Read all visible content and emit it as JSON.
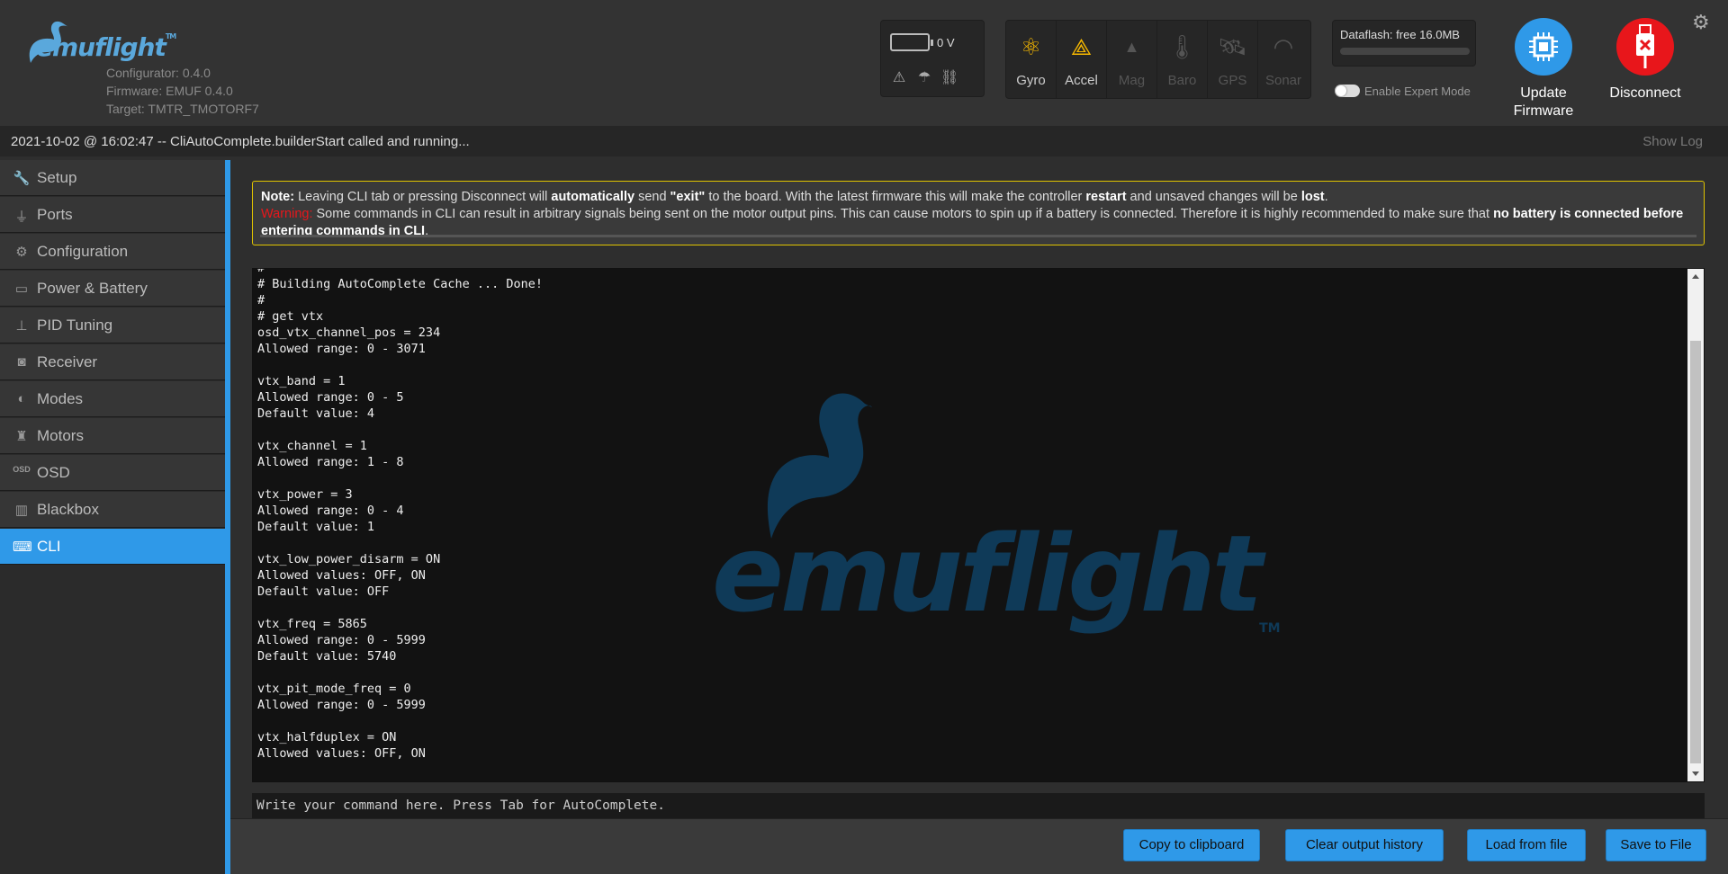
{
  "header": {
    "logo_text": "emuflight",
    "logo_tm": "TM",
    "configurator_version": "Configurator: 0.4.0",
    "firmware_version": "Firmware: EMUF 0.4.0",
    "target": "Target: TMTR_TMOTORF7",
    "battery_voltage": "0 V",
    "sensors": [
      {
        "label": "Gyro",
        "icon": "gyro-icon",
        "active": true
      },
      {
        "label": "Accel",
        "icon": "accel-icon",
        "active": true
      },
      {
        "label": "Mag",
        "icon": "mag-icon",
        "active": false
      },
      {
        "label": "Baro",
        "icon": "baro-icon",
        "active": false
      },
      {
        "label": "GPS",
        "icon": "gps-icon",
        "active": false
      },
      {
        "label": "Sonar",
        "icon": "sonar-icon",
        "active": false
      }
    ],
    "dataflash_label": "Dataflash: free 16.0MB",
    "expert_mode_label": "Enable Expert Mode",
    "update_firmware_label_1": "Update",
    "update_firmware_label_2": "Firmware",
    "disconnect_label": "Disconnect"
  },
  "logbar": {
    "message": "2021-10-02 @ 16:02:47 -- CliAutoComplete.builderStart called and running...",
    "show_log": "Show Log"
  },
  "sidebar": {
    "items": [
      {
        "label": "Setup",
        "icon": "wrench-icon"
      },
      {
        "label": "Ports",
        "icon": "plug-icon"
      },
      {
        "label": "Configuration",
        "icon": "gear-icon"
      },
      {
        "label": "Power & Battery",
        "icon": "battery-icon"
      },
      {
        "label": "PID Tuning",
        "icon": "sitemap-icon"
      },
      {
        "label": "Receiver",
        "icon": "robot-icon"
      },
      {
        "label": "Modes",
        "icon": "toggle-icon"
      },
      {
        "label": "Motors",
        "icon": "motor-icon"
      },
      {
        "label": "OSD",
        "icon": "osd-icon"
      },
      {
        "label": "Blackbox",
        "icon": "blackbox-icon"
      },
      {
        "label": "CLI",
        "icon": "terminal-icon"
      }
    ],
    "active": "CLI"
  },
  "note": {
    "note_label": "Note:",
    "note_text_1": " Leaving CLI tab or pressing Disconnect will ",
    "note_bold_1": "automatically",
    "note_text_2": " send ",
    "note_bold_2": "\"exit\"",
    "note_text_3": " to the board. With the latest firmware this will make the controller ",
    "note_bold_3": "restart",
    "note_text_4": " and unsaved changes will be ",
    "note_bold_4": "lost",
    "note_text_5": ".",
    "warning_label": "Warning:",
    "warning_text": " Some commands in CLI can result in arbitrary signals being sent on the motor output pins. This can cause motors to spin up if a battery is connected. Therefore it is highly recommended to make sure that ",
    "warning_bold": "no battery is connected before entering commands in CLI",
    "warning_end": "."
  },
  "console": {
    "watermark": "emuflight",
    "watermark_tm": "TM",
    "lines": [
      "#",
      "# Building AutoComplete Cache ... Done!",
      "#",
      "# get vtx",
      "osd_vtx_channel_pos = 234",
      "Allowed range: 0 - 3071",
      "",
      "vtx_band = 1",
      "Allowed range: 0 - 5",
      "Default value: 4",
      "",
      "vtx_channel = 1",
      "Allowed range: 1 - 8",
      "",
      "vtx_power = 3",
      "Allowed range: 0 - 4",
      "Default value: 1",
      "",
      "vtx_low_power_disarm = ON",
      "Allowed values: OFF, ON",
      "Default value: OFF",
      "",
      "vtx_freq = 5865",
      "Allowed range: 0 - 5999",
      "Default value: 5740",
      "",
      "vtx_pit_mode_freq = 0",
      "Allowed range: 0 - 5999",
      "",
      "vtx_halfduplex = ON",
      "Allowed values: OFF, ON"
    ]
  },
  "command_input": {
    "placeholder": "Write your command here. Press Tab for AutoComplete."
  },
  "actions": {
    "copy": "Copy to clipboard",
    "clear": "Clear output history",
    "load": "Load from file",
    "save": "Save to File"
  },
  "colors": {
    "accent": "#2f99e8",
    "disconnect": "#e8161b",
    "sensor_active": "#f5b700",
    "note_border": "#e0c400"
  }
}
